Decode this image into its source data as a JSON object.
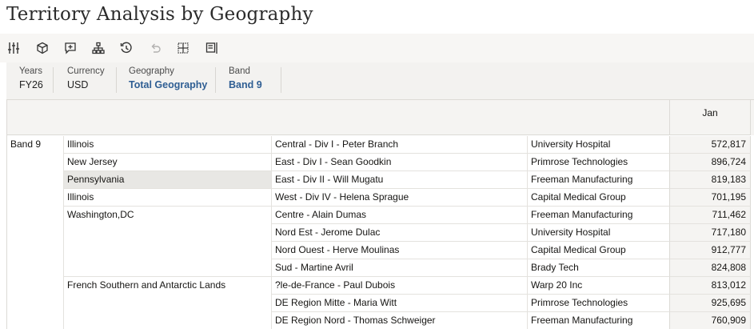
{
  "page": {
    "title": "Territory Analysis by Geography"
  },
  "toolbar": {
    "buttons": [
      {
        "icon": "sliders-icon"
      },
      {
        "icon": "cube-settings-icon"
      },
      {
        "icon": "add-comment-icon"
      },
      {
        "icon": "hierarchy-icon"
      },
      {
        "icon": "history-icon"
      },
      {
        "icon": "undo-icon",
        "disabled": true
      },
      {
        "icon": "grid-frame-icon"
      },
      {
        "icon": "panel-toggle-icon"
      }
    ]
  },
  "pov": [
    {
      "label": "Years",
      "value": "FY26",
      "link": false
    },
    {
      "label": "Currency",
      "value": "USD",
      "link": false
    },
    {
      "label": "Geography",
      "value": "Total Geography",
      "link": true
    },
    {
      "label": "Band",
      "value": "Band 9",
      "link": true
    }
  ],
  "grid": {
    "column_header": "Jan",
    "band": "Band 9",
    "rows": [
      {
        "geography": "Illinois",
        "territory": "Central -  Div I - Peter Branch",
        "customer": "University Hospital",
        "value": "572,817"
      },
      {
        "geography": "New Jersey",
        "territory": "East -  Div I - Sean Goodkin",
        "customer": "Primrose Technologies",
        "value": "896,724"
      },
      {
        "geography": "Pennsylvania",
        "territory": "East -  Div II - Will Mugatu",
        "customer": "Freeman Manufacturing",
        "value": "819,183"
      },
      {
        "geography": "Illinois",
        "territory": "West -  Div IV - Helena Sprague",
        "customer": "Capital Medical Group",
        "value": "701,195"
      },
      {
        "geography": "Washington,DC",
        "territory": "Centre - Alain Dumas",
        "customer": "Freeman Manufacturing",
        "value": "711,462"
      },
      {
        "geography": "",
        "territory": "Nord Est - Jerome Dulac",
        "customer": "University Hospital",
        "value": "717,180"
      },
      {
        "geography": "",
        "territory": "Nord Ouest - Herve Moulinas",
        "customer": "Capital Medical Group",
        "value": "912,777"
      },
      {
        "geography": "",
        "territory": "Sud - Martine Avril",
        "customer": "Brady Tech",
        "value": "824,808"
      },
      {
        "geography": "French Southern and Antarctic Lands",
        "territory": "?le-de-France - Paul Dubois",
        "customer": "Warp 20 Inc",
        "value": "813,012"
      },
      {
        "geography": "",
        "territory": "DE Region Mitte - Maria Witt",
        "customer": "Primrose Technologies",
        "value": "925,695"
      },
      {
        "geography": "",
        "territory": "DE Region Nord - Thomas Schweiger",
        "customer": "Freeman Manufacturing",
        "value": "760,909"
      }
    ]
  }
}
